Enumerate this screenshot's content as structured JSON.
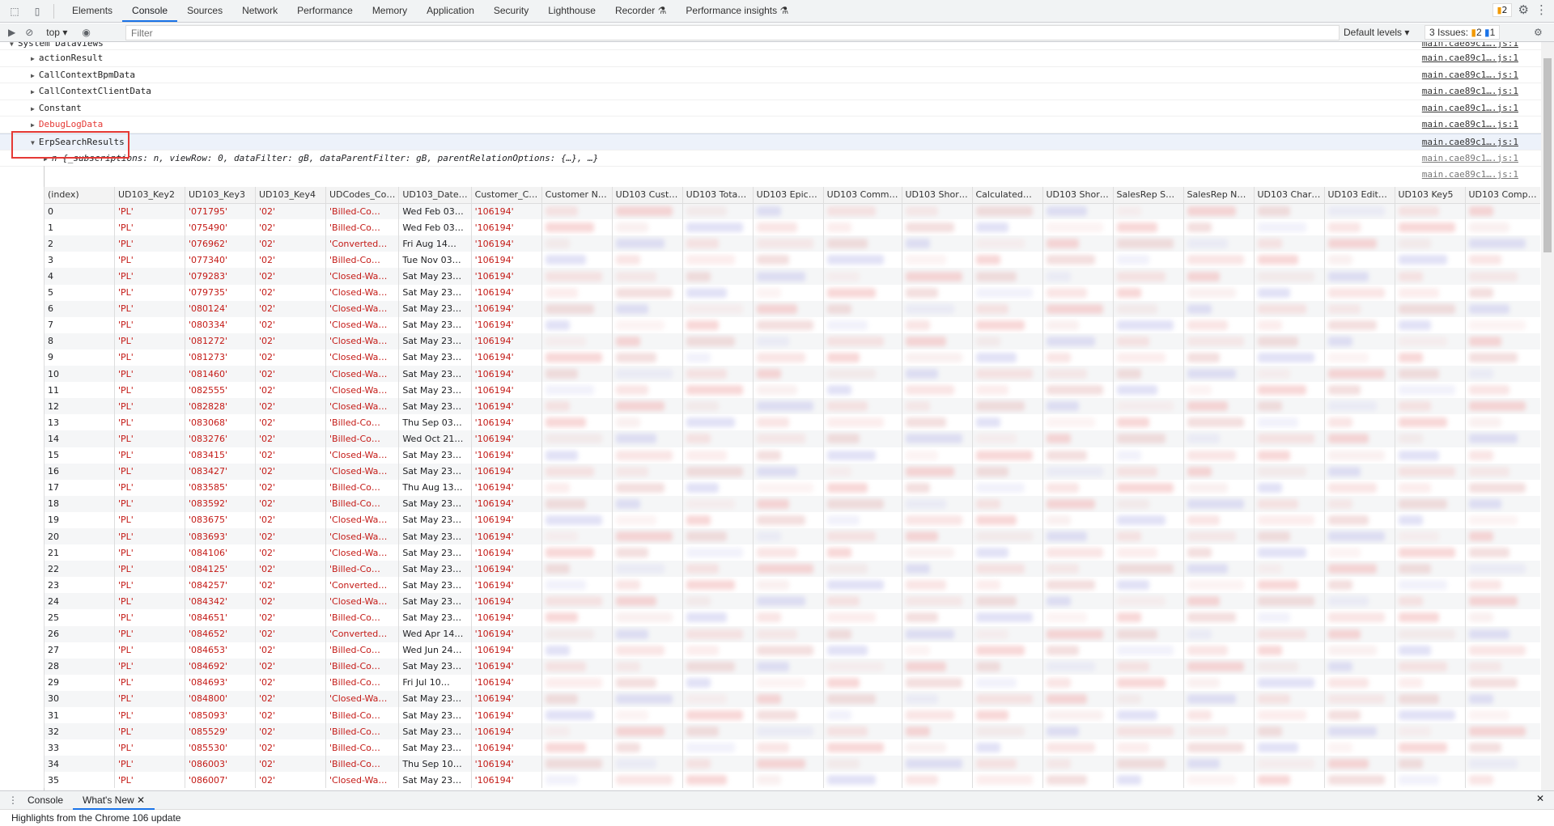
{
  "tabs": [
    "Elements",
    "Console",
    "Sources",
    "Network",
    "Performance",
    "Memory",
    "Application",
    "Security",
    "Lighthouse",
    "Recorder ⚗",
    "Performance insights ⚗"
  ],
  "active_tab": "Console",
  "issues_badge": "2",
  "toolbar": {
    "context": "top ▾",
    "filter_placeholder": "Filter",
    "levels": "Default levels ▾",
    "issues_label": "3 Issues:",
    "issues_warn": "2",
    "issues_info": "1"
  },
  "console": {
    "group": "System Dataviews",
    "source": "main.cae89c1….js:1",
    "items": [
      {
        "label": "actionResult",
        "color": "#222"
      },
      {
        "label": "CallContextBpmData",
        "color": "#222"
      },
      {
        "label": "CallContextClientData",
        "color": "#222"
      },
      {
        "label": "Constant",
        "color": "#222"
      },
      {
        "label": "DebugLogData",
        "color": "#e53935"
      },
      {
        "label": "ErpSearchResults",
        "color": "#222"
      }
    ],
    "object_preview": "n {_subscriptions: n, viewRow: 0, dataFilter: gB, dataParentFilter: gB, parentRelationOptions: {…}, …}"
  },
  "table": {
    "headers": [
      "(index)",
      "UD103_Key2",
      "UD103_Key3",
      "UD103_Key4",
      "UDCodes_Co…",
      "UD103_Date…",
      "Customer_C…",
      "Customer N…",
      "UD103 Cust…",
      "UD103 Tota…",
      "UD103 Epic…",
      "UD103 Comm…",
      "UD103 Shor…",
      "Calculated…",
      "UD103 Shor…",
      "SalesRep S…",
      "SalesRep N…",
      "UD103 Char…",
      "UD103 Edit…",
      "UD103 Key5",
      "UD103 Comp…"
    ],
    "rows": [
      [
        "0",
        "'PL'",
        "'071795'",
        "'02'",
        "'Billed-Co…",
        "Wed Feb 03…",
        "'106194'"
      ],
      [
        "1",
        "'PL'",
        "'075490'",
        "'02'",
        "'Billed-Co…",
        "Wed Feb 03…",
        "'106194'"
      ],
      [
        "2",
        "'PL'",
        "'076962'",
        "'02'",
        "'Converted…",
        "Fri Aug 14…",
        "'106194'"
      ],
      [
        "3",
        "'PL'",
        "'077340'",
        "'02'",
        "'Billed-Co…",
        "Tue Nov 03…",
        "'106194'"
      ],
      [
        "4",
        "'PL'",
        "'079283'",
        "'02'",
        "'Closed-Wa…",
        "Sat May 23…",
        "'106194'"
      ],
      [
        "5",
        "'PL'",
        "'079735'",
        "'02'",
        "'Closed-Wa…",
        "Sat May 23…",
        "'106194'"
      ],
      [
        "6",
        "'PL'",
        "'080124'",
        "'02'",
        "'Closed-Wa…",
        "Sat May 23…",
        "'106194'"
      ],
      [
        "7",
        "'PL'",
        "'080334'",
        "'02'",
        "'Closed-Wa…",
        "Sat May 23…",
        "'106194'"
      ],
      [
        "8",
        "'PL'",
        "'081272'",
        "'02'",
        "'Closed-Wa…",
        "Sat May 23…",
        "'106194'"
      ],
      [
        "9",
        "'PL'",
        "'081273'",
        "'02'",
        "'Closed-Wa…",
        "Sat May 23…",
        "'106194'"
      ],
      [
        "10",
        "'PL'",
        "'081460'",
        "'02'",
        "'Closed-Wa…",
        "Sat May 23…",
        "'106194'"
      ],
      [
        "11",
        "'PL'",
        "'082555'",
        "'02'",
        "'Closed-Wa…",
        "Sat May 23…",
        "'106194'"
      ],
      [
        "12",
        "'PL'",
        "'082828'",
        "'02'",
        "'Closed-Wa…",
        "Sat May 23…",
        "'106194'"
      ],
      [
        "13",
        "'PL'",
        "'083068'",
        "'02'",
        "'Billed-Co…",
        "Thu Sep 03…",
        "'106194'"
      ],
      [
        "14",
        "'PL'",
        "'083276'",
        "'02'",
        "'Billed-Co…",
        "Wed Oct 21…",
        "'106194'"
      ],
      [
        "15",
        "'PL'",
        "'083415'",
        "'02'",
        "'Closed-Wa…",
        "Sat May 23…",
        "'106194'"
      ],
      [
        "16",
        "'PL'",
        "'083427'",
        "'02'",
        "'Closed-Wa…",
        "Sat May 23…",
        "'106194'"
      ],
      [
        "17",
        "'PL'",
        "'083585'",
        "'02'",
        "'Billed-Co…",
        "Thu Aug 13…",
        "'106194'"
      ],
      [
        "18",
        "'PL'",
        "'083592'",
        "'02'",
        "'Billed-Co…",
        "Sat May 23…",
        "'106194'"
      ],
      [
        "19",
        "'PL'",
        "'083675'",
        "'02'",
        "'Closed-Wa…",
        "Sat May 23…",
        "'106194'"
      ],
      [
        "20",
        "'PL'",
        "'083693'",
        "'02'",
        "'Closed-Wa…",
        "Sat May 23…",
        "'106194'"
      ],
      [
        "21",
        "'PL'",
        "'084106'",
        "'02'",
        "'Closed-Wa…",
        "Sat May 23…",
        "'106194'"
      ],
      [
        "22",
        "'PL'",
        "'084125'",
        "'02'",
        "'Billed-Co…",
        "Sat May 23…",
        "'106194'"
      ],
      [
        "23",
        "'PL'",
        "'084257'",
        "'02'",
        "'Converted…",
        "Sat May 23…",
        "'106194'"
      ],
      [
        "24",
        "'PL'",
        "'084342'",
        "'02'",
        "'Closed-Wa…",
        "Sat May 23…",
        "'106194'"
      ],
      [
        "25",
        "'PL'",
        "'084651'",
        "'02'",
        "'Billed-Co…",
        "Sat May 23…",
        "'106194'"
      ],
      [
        "26",
        "'PL'",
        "'084652'",
        "'02'",
        "'Converted…",
        "Wed Apr 14…",
        "'106194'"
      ],
      [
        "27",
        "'PL'",
        "'084653'",
        "'02'",
        "'Billed-Co…",
        "Wed Jun 24…",
        "'106194'"
      ],
      [
        "28",
        "'PL'",
        "'084692'",
        "'02'",
        "'Billed-Co…",
        "Sat May 23…",
        "'106194'"
      ],
      [
        "29",
        "'PL'",
        "'084693'",
        "'02'",
        "'Billed-Co…",
        "Fri Jul 10…",
        "'106194'"
      ],
      [
        "30",
        "'PL'",
        "'084800'",
        "'02'",
        "'Closed-Wa…",
        "Sat May 23…",
        "'106194'"
      ],
      [
        "31",
        "'PL'",
        "'085093'",
        "'02'",
        "'Billed-Co…",
        "Sat May 23…",
        "'106194'"
      ],
      [
        "32",
        "'PL'",
        "'085529'",
        "'02'",
        "'Billed-Co…",
        "Sat May 23…",
        "'106194'"
      ],
      [
        "33",
        "'PL'",
        "'085530'",
        "'02'",
        "'Billed-Co…",
        "Sat May 23…",
        "'106194'"
      ],
      [
        "34",
        "'PL'",
        "'086003'",
        "'02'",
        "'Billed-Co…",
        "Thu Sep 10…",
        "'106194'"
      ],
      [
        "35",
        "'PL'",
        "'086007'",
        "'02'",
        "'Closed-Wa…",
        "Sat May 23…",
        "'106194'"
      ]
    ]
  },
  "drawer": {
    "tabs": [
      "Console",
      "What's New"
    ],
    "close": "✕",
    "text": "Highlights from the Chrome 106 update"
  }
}
